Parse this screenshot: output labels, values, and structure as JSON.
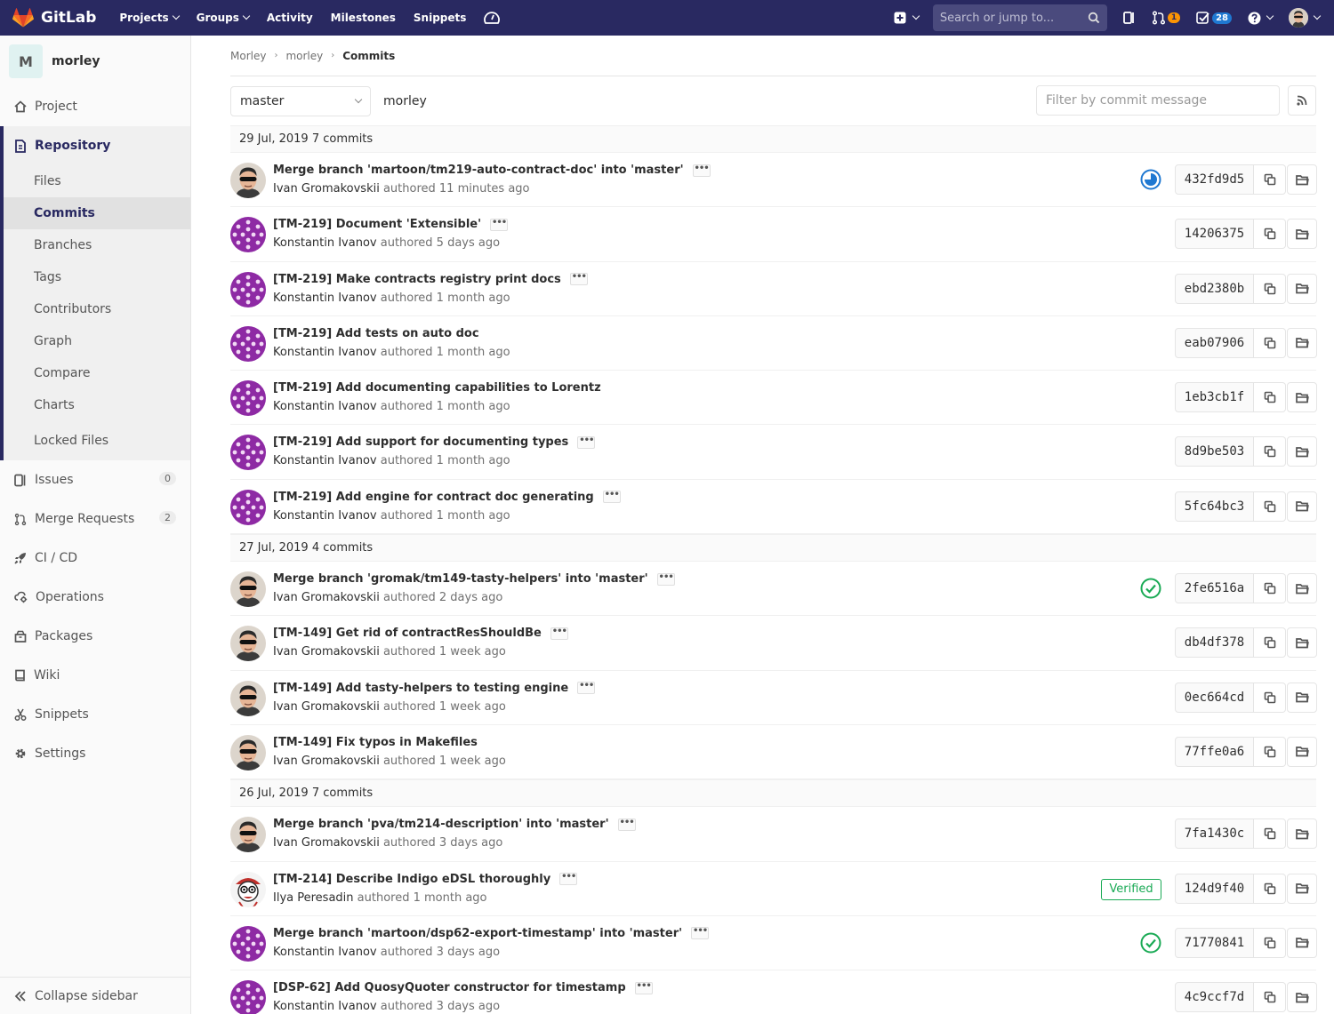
{
  "navbar": {
    "brand": "GitLab",
    "links": [
      {
        "label": "Projects",
        "has_dropdown": true
      },
      {
        "label": "Groups",
        "has_dropdown": true
      },
      {
        "label": "Activity",
        "has_dropdown": false
      },
      {
        "label": "Milestones",
        "has_dropdown": false
      },
      {
        "label": "Snippets",
        "has_dropdown": false
      }
    ],
    "search_placeholder": "Search or jump to...",
    "merge_requests_count": "1",
    "todos_count": "28",
    "colors": {
      "background": "#292961",
      "accent": "#fc6d26"
    }
  },
  "sidebar": {
    "project_initial": "M",
    "project_name": "morley",
    "project_label": "Project",
    "repository_label": "Repository",
    "repository_items": [
      "Files",
      "Commits",
      "Branches",
      "Tags",
      "Contributors",
      "Graph",
      "Compare",
      "Charts",
      "Locked Files"
    ],
    "active_item": "Commits",
    "items": [
      {
        "label": "Issues",
        "icon": "issues-icon",
        "count": "0"
      },
      {
        "label": "Merge Requests",
        "icon": "merge-request-icon",
        "count": "2"
      },
      {
        "label": "CI / CD",
        "icon": "rocket-icon"
      },
      {
        "label": "Operations",
        "icon": "cloud-gear-icon"
      },
      {
        "label": "Packages",
        "icon": "package-icon"
      },
      {
        "label": "Wiki",
        "icon": "book-icon"
      },
      {
        "label": "Snippets",
        "icon": "scissors-icon"
      },
      {
        "label": "Settings",
        "icon": "gear-icon"
      }
    ],
    "collapse_label": "Collapse sidebar"
  },
  "breadcrumb": [
    "Morley",
    "morley",
    "Commits"
  ],
  "controls": {
    "branch": "master",
    "path": "morley",
    "filter_placeholder": "Filter by commit message"
  },
  "days": [
    {
      "date": "29 Jul, 2019",
      "count_label": "7 commits",
      "commits": [
        {
          "title": "Merge branch 'martoon/tm219-auto-contract-doc' into 'master'",
          "author": "Ivan Gromakovskii",
          "time": "authored 11 minutes ago",
          "sha": "432fd9d5",
          "avatar": "ivan",
          "status": "running",
          "ellipsis": true
        },
        {
          "title": "[TM-219] Document 'Extensible'",
          "author": "Konstantin Ivanov",
          "time": "authored 5 days ago",
          "sha": "14206375",
          "avatar": "purple",
          "ellipsis": true
        },
        {
          "title": "[TM-219] Make contracts registry print docs",
          "author": "Konstantin Ivanov",
          "time": "authored 1 month ago",
          "sha": "ebd2380b",
          "avatar": "purple",
          "ellipsis": true
        },
        {
          "title": "[TM-219] Add tests on auto doc",
          "author": "Konstantin Ivanov",
          "time": "authored 1 month ago",
          "sha": "eab07906",
          "avatar": "purple",
          "ellipsis": false
        },
        {
          "title": "[TM-219] Add documenting capabilities to Lorentz",
          "author": "Konstantin Ivanov",
          "time": "authored 1 month ago",
          "sha": "1eb3cb1f",
          "avatar": "purple",
          "ellipsis": false
        },
        {
          "title": "[TM-219] Add support for documenting types",
          "author": "Konstantin Ivanov",
          "time": "authored 1 month ago",
          "sha": "8d9be503",
          "avatar": "purple",
          "ellipsis": true
        },
        {
          "title": "[TM-219] Add engine for contract doc generating",
          "author": "Konstantin Ivanov",
          "time": "authored 1 month ago",
          "sha": "5fc64bc3",
          "avatar": "purple",
          "ellipsis": true
        }
      ]
    },
    {
      "date": "27 Jul, 2019",
      "count_label": "4 commits",
      "commits": [
        {
          "title": "Merge branch 'gromak/tm149-tasty-helpers' into 'master'",
          "author": "Ivan Gromakovskii",
          "time": "authored 2 days ago",
          "sha": "2fe6516a",
          "avatar": "ivan",
          "status": "passed",
          "ellipsis": true
        },
        {
          "title": "[TM-149] Get rid of contractResShouldBe",
          "author": "Ivan Gromakovskii",
          "time": "authored 1 week ago",
          "sha": "db4df378",
          "avatar": "ivan",
          "ellipsis": true
        },
        {
          "title": "[TM-149] Add tasty-helpers to testing engine",
          "author": "Ivan Gromakovskii",
          "time": "authored 1 week ago",
          "sha": "0ec664cd",
          "avatar": "ivan",
          "ellipsis": true
        },
        {
          "title": "[TM-149] Fix typos in Makefiles",
          "author": "Ivan Gromakovskii",
          "time": "authored 1 week ago",
          "sha": "77ffe0a6",
          "avatar": "ivan",
          "ellipsis": false
        }
      ]
    },
    {
      "date": "26 Jul, 2019",
      "count_label": "7 commits",
      "commits": [
        {
          "title": "Merge branch 'pva/tm214-description' into 'master'",
          "author": "Ivan Gromakovskii",
          "time": "authored 3 days ago",
          "sha": "7fa1430c",
          "avatar": "ivan",
          "ellipsis": true
        },
        {
          "title": "[TM-214] Describe Indigo eDSL thoroughly",
          "author": "Ilya Peresadin",
          "time": "authored 1 month ago",
          "sha": "124d9f40",
          "avatar": "ilya",
          "verified": "Verified",
          "ellipsis": true
        },
        {
          "title": "Merge branch 'martoon/dsp62-export-timestamp' into 'master'",
          "author": "Konstantin Ivanov",
          "time": "authored 3 days ago",
          "sha": "71770841",
          "avatar": "purple",
          "status": "passed",
          "ellipsis": true
        },
        {
          "title": "[DSP-62] Add QuosyQuoter constructor for timestamp",
          "author": "Konstantin Ivanov",
          "time": "authored 3 days ago",
          "sha": "4c9ccf7d",
          "avatar": "purple",
          "ellipsis": true
        }
      ]
    }
  ]
}
